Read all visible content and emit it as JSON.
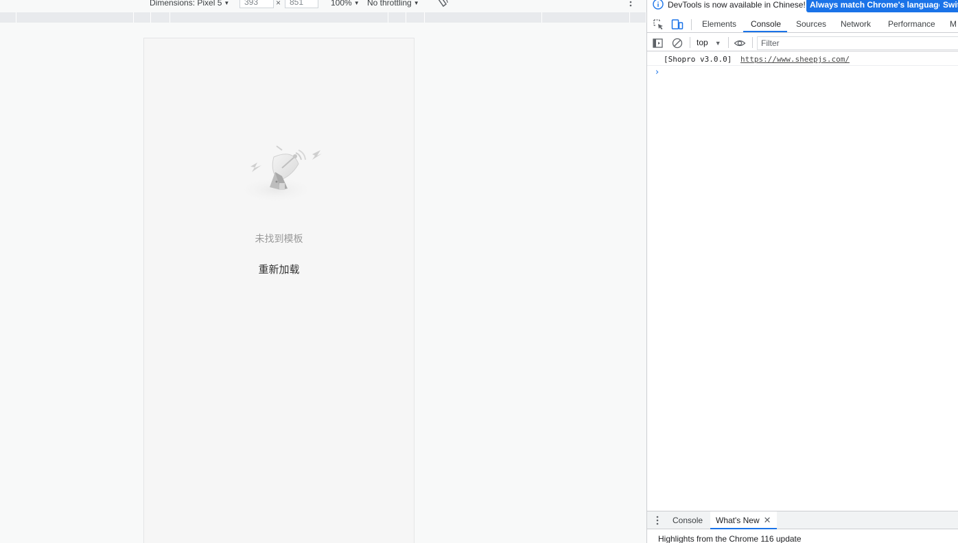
{
  "device_toolbar": {
    "dimensions_label": "Dimensions: Pixel 5",
    "width_value": "393",
    "height_value": "851",
    "times_symbol": "×",
    "zoom_label": "100%",
    "throttling_label": "No throttling",
    "rotate_icon": "rotate-icon",
    "more_icon": "more-vertical-icon"
  },
  "viewport": {
    "empty_message": "未找到模板",
    "reload_label": "重新加载",
    "illustration_icon": "satellite-dish-icon"
  },
  "devtools": {
    "info_bar": {
      "message": "DevTools is now available in Chinese!",
      "match_button": "Always match Chrome's language",
      "switch_button": "Swit"
    },
    "tabs": [
      {
        "label": "Elements"
      },
      {
        "label": "Console"
      },
      {
        "label": "Sources"
      },
      {
        "label": "Network"
      },
      {
        "label": "Performance"
      },
      {
        "label": "M"
      }
    ],
    "active_tab": "Console",
    "console_toolbar": {
      "context": "top",
      "filter_placeholder": "Filter"
    },
    "messages": [
      {
        "text": "[Shopro v3.0.0]",
        "link": "https://www.sheepjs.com/"
      }
    ],
    "drawer": {
      "tabs": [
        {
          "label": "Console"
        },
        {
          "label": "What's New"
        }
      ],
      "active_tab": "What's New",
      "content": "Highlights from the Chrome 116 update"
    }
  },
  "colors": {
    "accent": "#1a73e8",
    "page_bg": "#f8f9f9",
    "viewport_bg": "#f6f6f6",
    "muted_text": "#999999"
  }
}
